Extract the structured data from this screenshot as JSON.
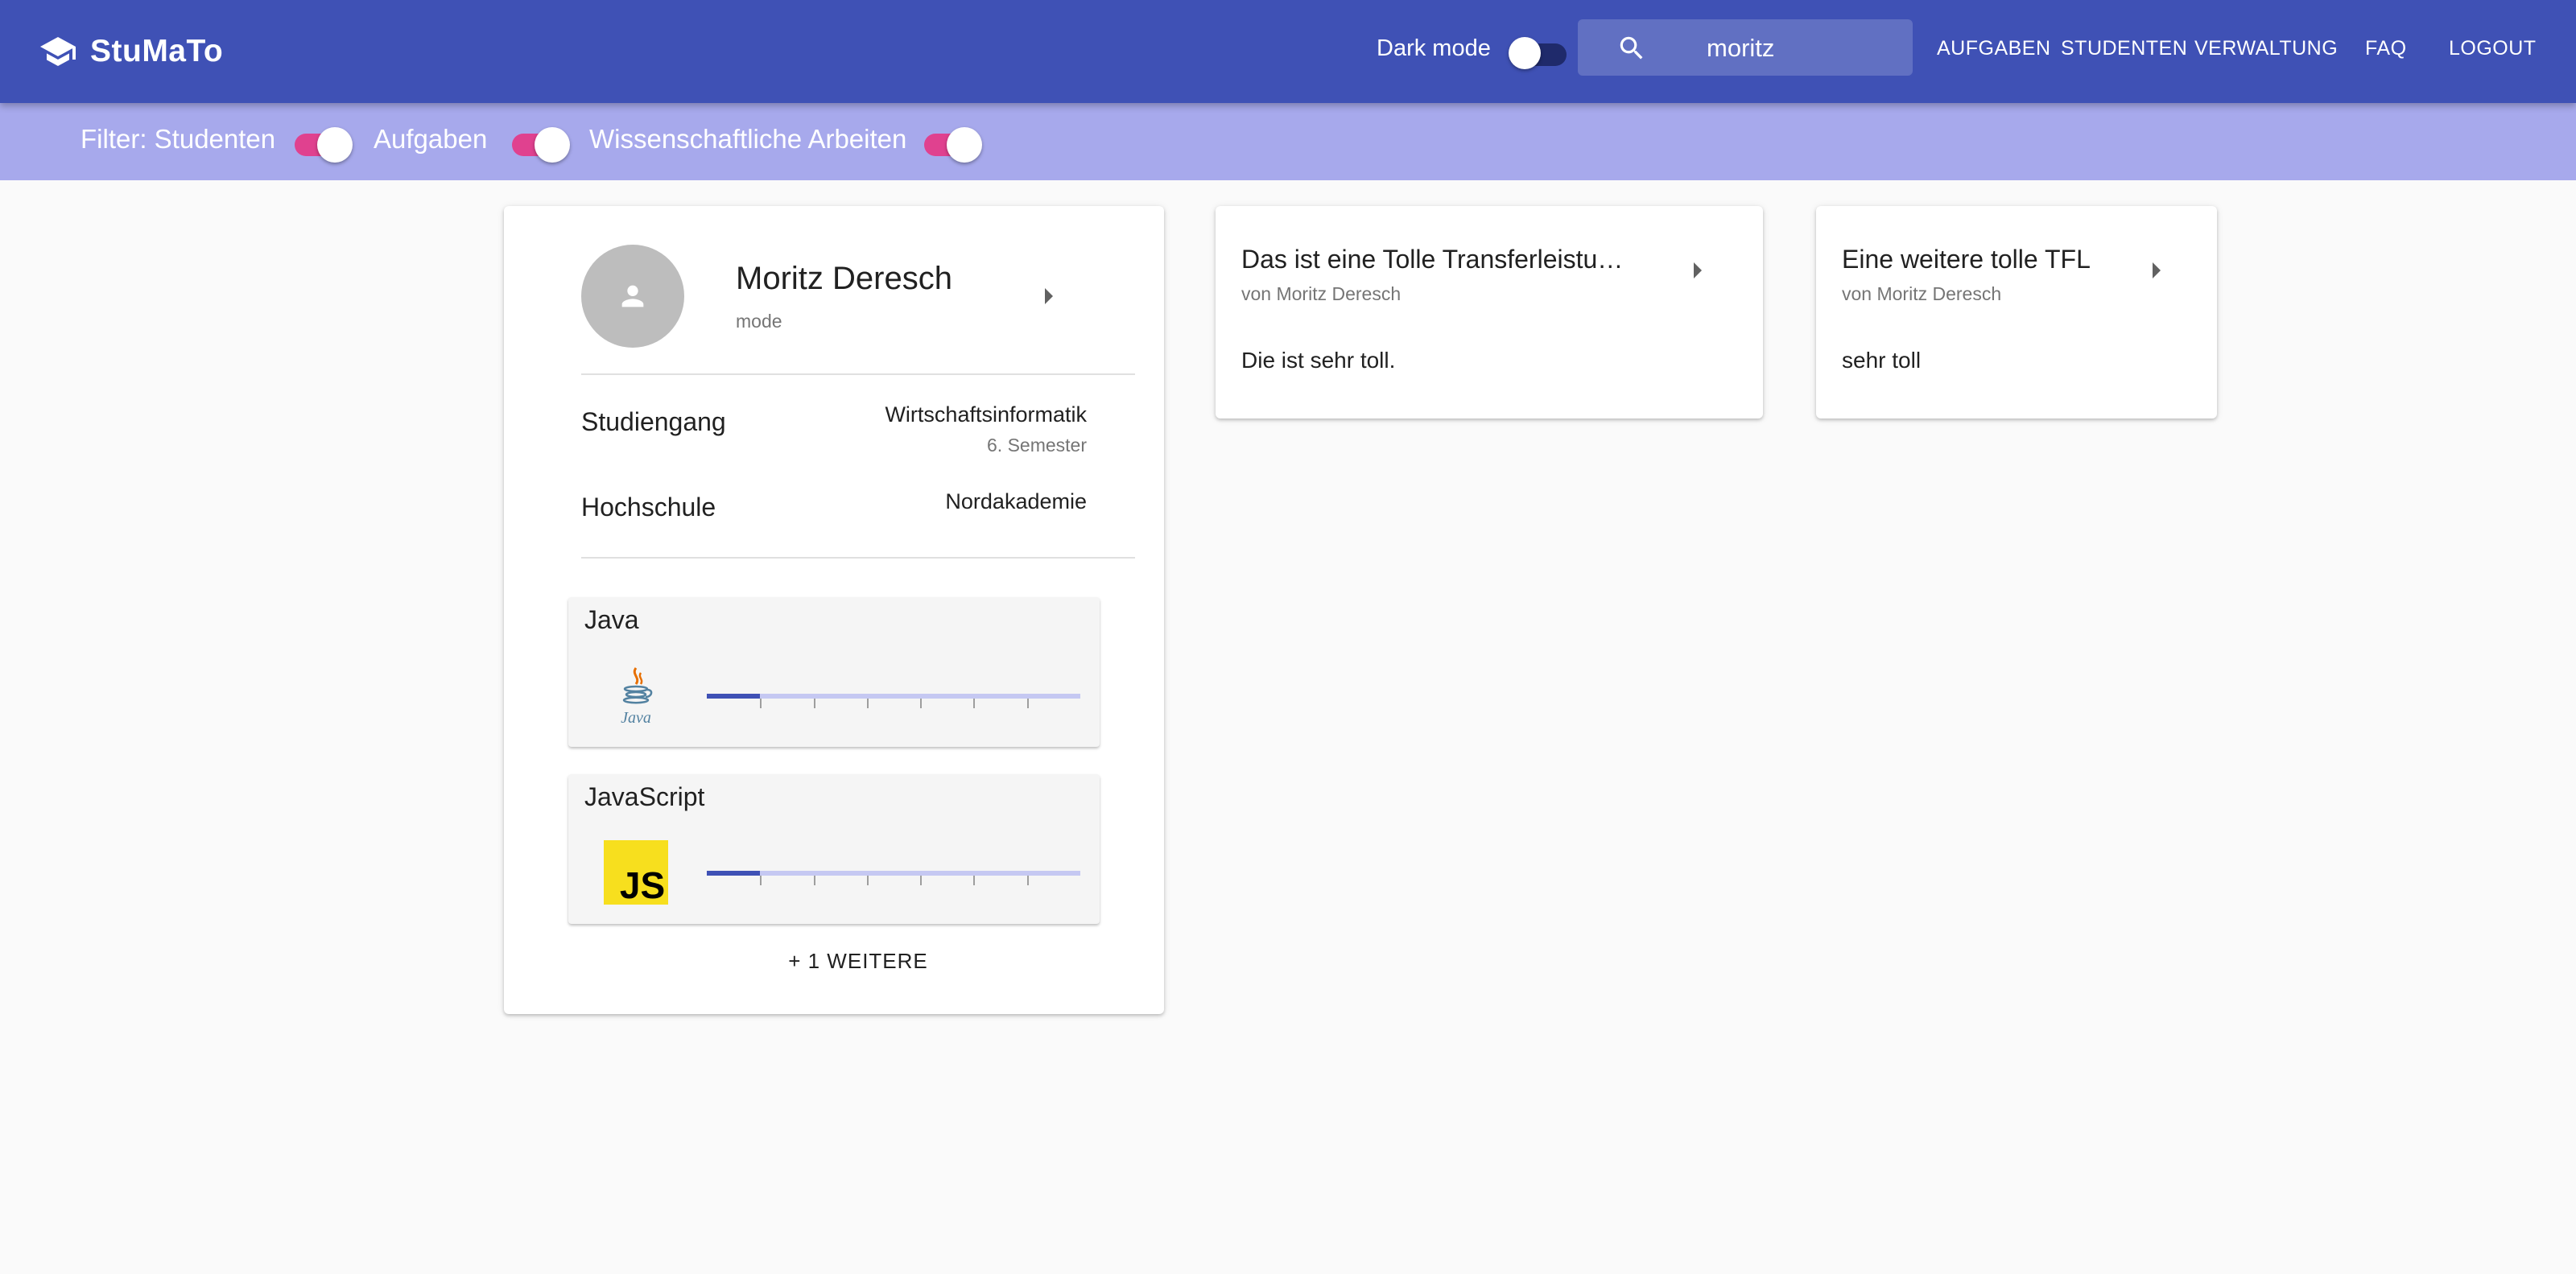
{
  "app": {
    "name": "StuMaTo"
  },
  "header": {
    "dark_mode_label": "Dark mode",
    "dark_mode_enabled": false,
    "search": {
      "value": "moritz"
    },
    "nav": [
      "AUFGABEN",
      "STUDENTEN",
      "VERWALTUNG",
      "FAQ",
      "LOGOUT"
    ]
  },
  "filters": {
    "label": "Filter: Studenten",
    "items": [
      {
        "label": "Filter: Studenten",
        "enabled": true
      },
      {
        "label": "Aufgaben",
        "enabled": true
      },
      {
        "label": "Wissenschaftliche Arbeiten",
        "enabled": true
      }
    ]
  },
  "student": {
    "name": "Moritz Deresch",
    "username": "mode",
    "rows": [
      {
        "label": "Studiengang",
        "value": "Wirtschaftsinformatik",
        "sub": "6. Semester"
      },
      {
        "label": "Hochschule",
        "value": "Nordakademie",
        "sub": ""
      }
    ],
    "skills": [
      {
        "name": "Java",
        "logo": "java-logo",
        "level": 1,
        "max": 7
      },
      {
        "name": "JavaScript",
        "logo": "javascript-logo",
        "logo_text": "JS",
        "level": 1,
        "max": 7
      }
    ],
    "more_label": "+ 1 WEITERE"
  },
  "transfer_works": [
    {
      "title": "Das ist eine Tolle Transferleistu…",
      "author": "von Moritz Deresch",
      "description": "Die ist sehr toll."
    },
    {
      "title": "Eine weitere tolle TFL",
      "author": "von Moritz Deresch",
      "description": "sehr toll"
    }
  ],
  "colors": {
    "primary": "#3f51b5",
    "filterbar": "#a7a9ec",
    "toggle_on": "#e0418f",
    "background": "#fafafa"
  }
}
